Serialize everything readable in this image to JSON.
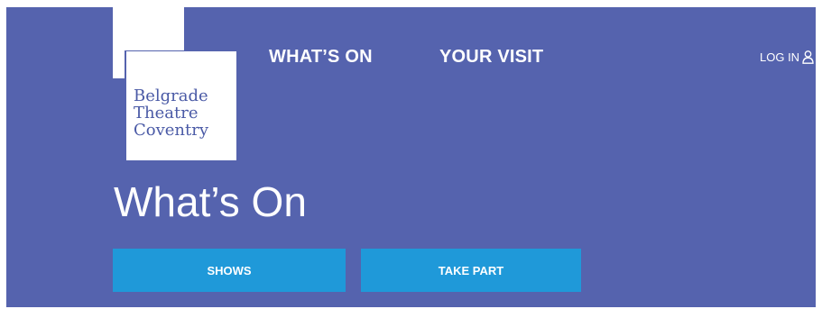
{
  "logo": {
    "lines": [
      "Belgrade",
      "Theatre",
      "Coventry"
    ]
  },
  "nav": {
    "items": [
      {
        "label": "WHAT’S ON"
      },
      {
        "label": "YOUR VISIT"
      }
    ],
    "login_label": "LOG IN",
    "login_icon": "user-icon"
  },
  "page": {
    "title": "What’s On"
  },
  "tabs": [
    {
      "label": "SHOWS"
    },
    {
      "label": "TAKE PART"
    }
  ],
  "colors": {
    "header_bg": "#5563ae",
    "logo_text": "#4a5aa6",
    "button_bg": "#1f99d9",
    "text_light": "#ffffff"
  }
}
